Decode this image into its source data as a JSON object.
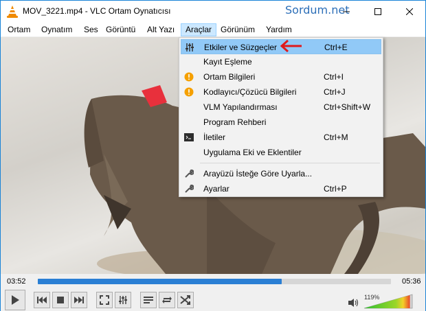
{
  "window": {
    "title": "MOV_3221.mp4 - VLC Ortam Oynatıcısı",
    "watermark": "Sordum.net"
  },
  "menubar": {
    "items": [
      {
        "label": "Ortam"
      },
      {
        "label": "Oynatım"
      },
      {
        "label": "Ses"
      },
      {
        "label": "Görüntü"
      },
      {
        "label": "Alt Yazı"
      },
      {
        "label": "Araçlar",
        "active": true
      },
      {
        "label": "Görünüm"
      },
      {
        "label": "Yardım"
      }
    ]
  },
  "tools_menu": {
    "items": [
      {
        "label": "Etkiler ve Süzgeçler",
        "shortcut": "Ctrl+E",
        "icon": "equalizer-icon",
        "highlighted": true
      },
      {
        "label": "Kayıt Eşleme",
        "shortcut": ""
      },
      {
        "label": "Ortam Bilgileri",
        "shortcut": "Ctrl+I",
        "icon": "info-icon"
      },
      {
        "label": "Kodlayıcı/Çözücü Bilgileri",
        "shortcut": "Ctrl+J",
        "icon": "info-icon"
      },
      {
        "label": "VLM Yapılandırması",
        "shortcut": "Ctrl+Shift+W"
      },
      {
        "label": "Program Rehberi",
        "shortcut": ""
      },
      {
        "label": "İletiler",
        "shortcut": "Ctrl+M",
        "icon": "terminal-icon"
      },
      {
        "label": "Uygulama Eki ve Eklentiler",
        "shortcut": ""
      },
      {
        "label": "Arayüzü İsteğe Göre Uyarla...",
        "shortcut": "",
        "icon": "wrench-icon"
      },
      {
        "label": "Ayarlar",
        "shortcut": "Ctrl+P",
        "icon": "wrench-icon"
      }
    ]
  },
  "player": {
    "time_current": "03:52",
    "time_total": "05:36",
    "progress": 0.69,
    "volume_label": "119%",
    "volume": 1.19
  },
  "colors": {
    "accent": "#2a7fd4",
    "menu_highlight": "#91c9f7",
    "arrow": "#e0191b"
  }
}
